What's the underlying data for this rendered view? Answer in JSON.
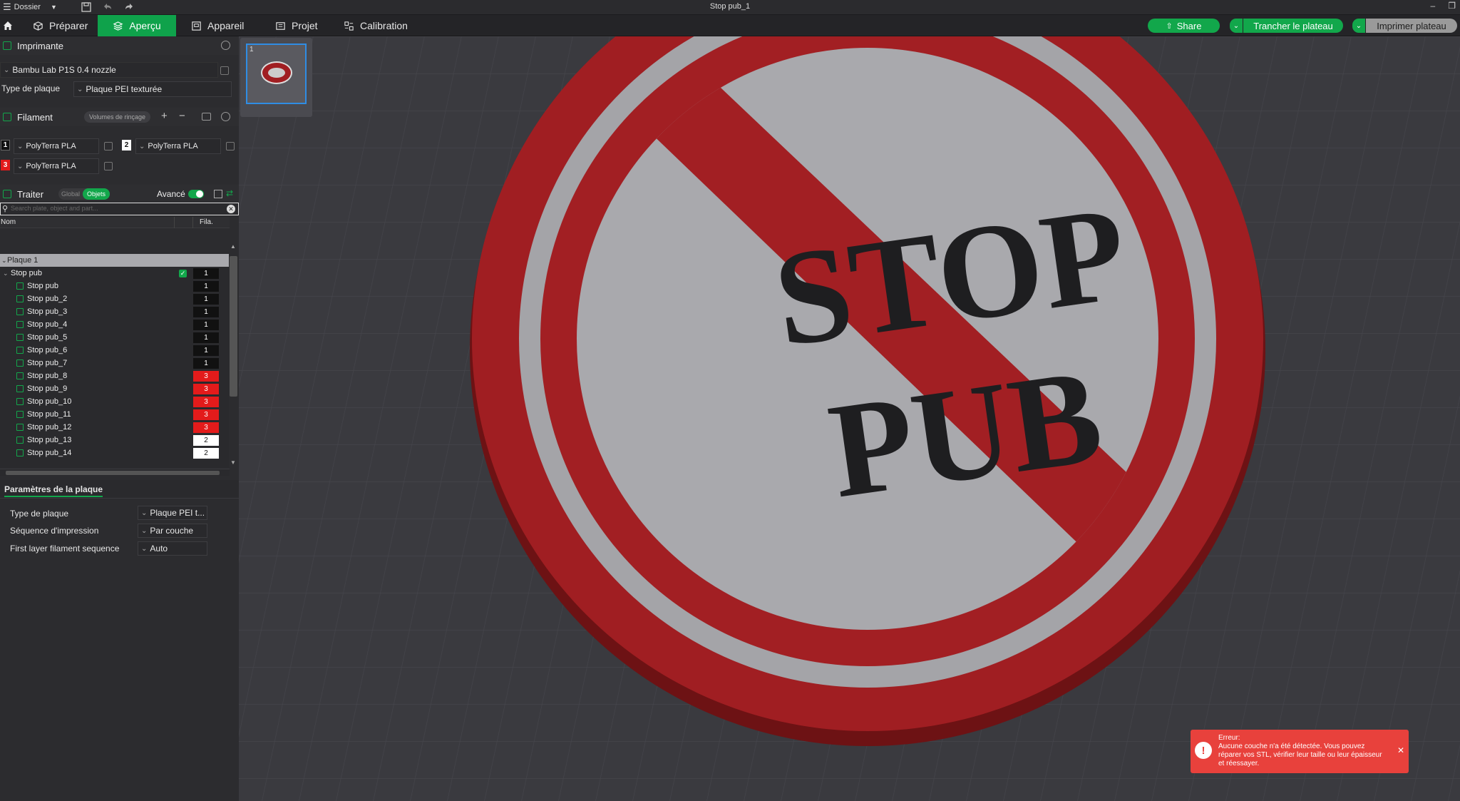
{
  "titlebar": {
    "menu_label": "Dossier",
    "window_title": "Stop pub_1"
  },
  "nav": {
    "tabs": [
      {
        "label": "Préparer"
      },
      {
        "label": "Aperçu"
      },
      {
        "label": "Appareil"
      },
      {
        "label": "Projet"
      },
      {
        "label": "Calibration"
      }
    ],
    "share_label": "Share",
    "slice_label": "Trancher le plateau",
    "print_label": "Imprimer plateau"
  },
  "printer": {
    "section_title": "Imprimante",
    "printer_name": "Bambu Lab P1S 0.4 nozzle",
    "plate_type_label": "Type de plaque",
    "plate_type_value": "Plaque PEI texturée"
  },
  "filament": {
    "section_title": "Filament",
    "flush_label": "Volumes de rinçage",
    "slots": [
      {
        "num": "1",
        "name": "PolyTerra PLA",
        "color": "#111111"
      },
      {
        "num": "2",
        "name": "PolyTerra PLA",
        "color": "#ffffff"
      },
      {
        "num": "3",
        "name": "PolyTerra PLA",
        "color": "#e31b1b"
      }
    ]
  },
  "process": {
    "section_title": "Traiter",
    "global_label": "Global",
    "objects_label": "Objets",
    "advanced_label": "Avancé",
    "advanced_on": true,
    "search_placeholder": "Search plate, object and part..."
  },
  "objects": {
    "col_name": "Nom",
    "col_fil": "Fila.",
    "plate_label": "Plaque 1",
    "root": {
      "name": "Stop pub",
      "fil": "1"
    },
    "parts": [
      {
        "name": "Stop pub",
        "fil": "1"
      },
      {
        "name": "Stop pub_2",
        "fil": "1"
      },
      {
        "name": "Stop pub_3",
        "fil": "1"
      },
      {
        "name": "Stop pub_4",
        "fil": "1"
      },
      {
        "name": "Stop pub_5",
        "fil": "1"
      },
      {
        "name": "Stop pub_6",
        "fil": "1"
      },
      {
        "name": "Stop pub_7",
        "fil": "1"
      },
      {
        "name": "Stop pub_8",
        "fil": "3"
      },
      {
        "name": "Stop pub_9",
        "fil": "3"
      },
      {
        "name": "Stop pub_10",
        "fil": "3"
      },
      {
        "name": "Stop pub_11",
        "fil": "3"
      },
      {
        "name": "Stop pub_12",
        "fil": "3"
      },
      {
        "name": "Stop pub_13",
        "fil": "2"
      },
      {
        "name": "Stop pub_14",
        "fil": "2"
      }
    ]
  },
  "plate_params": {
    "title": "Paramètres de la plaque",
    "rows": [
      {
        "label": "Type de plaque",
        "value": "Plaque PEI t..."
      },
      {
        "label": "Séquence d'impression",
        "value": "Par couche"
      },
      {
        "label": "First layer filament sequence",
        "value": "Auto"
      }
    ]
  },
  "viewport": {
    "plate_thumb_number": "1",
    "model_line1": "STOP",
    "model_line2": "PUB"
  },
  "error_toast": {
    "title": "Erreur:",
    "message": "Aucune couche n'a été détectée. Vous pouvez réparer vos STL, vérifier leur taille ou leur épaisseur et réessayer."
  },
  "colors": {
    "accent": "#12a74b",
    "error": "#e8413c",
    "sign_red": "#9e1f22",
    "sign_gray": "#a4a4a8"
  }
}
